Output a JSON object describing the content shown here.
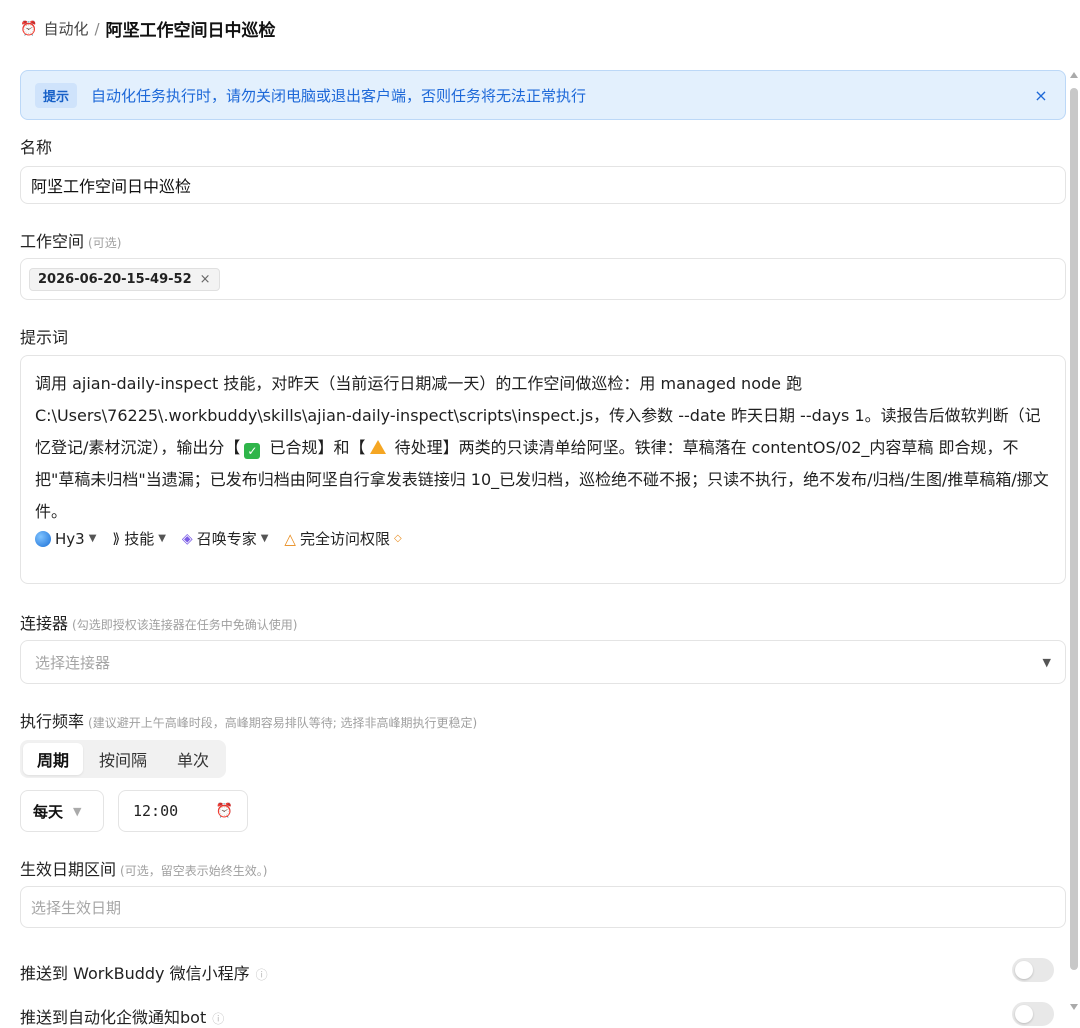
{
  "header": {
    "crumb": "自动化",
    "separator": "/",
    "title": "阿坚工作空间日中巡检"
  },
  "alert": {
    "tag": "提示",
    "message": "自动化任务执行时，请勿关闭电脑或退出客户端，否则任务将无法正常执行",
    "close": "×"
  },
  "name": {
    "label": "名称",
    "value": "阿坚工作空间日中巡检"
  },
  "workspace": {
    "label": "工作空间",
    "hint": "(可选)",
    "chip": "2026-06-20-15-49-52",
    "chip_remove": "×"
  },
  "prompt": {
    "label": "提示词",
    "part1": "调用 ajian-daily-inspect 技能，对昨天（当前运行日期减一天）的工作空间做巡检：用 managed node 跑 C:\\Users\\76225\\.workbuddy\\skills\\ajian-daily-inspect\\scripts\\inspect.js，传入参数 --date 昨天日期 --days 1。读报告后做软判断（记忆登记/素材沉淀），输出分【",
    "check_glyph": "✓",
    "part2": " 已合规】和【",
    "part3": " 待处理】两类的只读清单给阿坚。铁律：草稿落在 contentOS/02_内容草稿 即合规，不把\"草稿未归档\"当遗漏；已发布归档由阿坚自行拿发表链接归 10_已发归档，巡检绝不碰不报；只读不执行，绝不发布/归档/生图/推草稿箱/挪文件。",
    "toolbar": {
      "model": "Hy3",
      "skills": "技能",
      "expert": "召唤专家",
      "access": "完全访问权限"
    }
  },
  "connector": {
    "label": "连接器",
    "hint": "(勾选即授权该连接器在任务中免确认使用)",
    "placeholder": "选择连接器"
  },
  "frequency": {
    "label": "执行频率",
    "hint": "(建议避开上午高峰时段，高峰期容易排队等待; 选择非高峰期执行更稳定)",
    "tabs": [
      "周期",
      "按间隔",
      "单次"
    ],
    "period": "每天",
    "time": "12:00"
  },
  "date_range": {
    "label": "生效日期区间",
    "hint": "(可选，留空表示始终生效。)",
    "placeholder": "选择生效日期"
  },
  "push_wechat": {
    "label": "推送到 WorkBuddy 微信小程序"
  },
  "push_bot": {
    "label": "推送到自动化企微通知bot"
  },
  "colors": {
    "alert_bg": "#e3f0fd",
    "alert_text": "#1d68d8",
    "check_green": "#2fb54a",
    "warn_orange": "#e88a1a"
  },
  "icons": {
    "header": "alarm-clock-icon",
    "time": "alarm-clock-icon",
    "model": "hy-model-icon",
    "skills": "skill-icon",
    "expert": "graduation-cap-icon",
    "access": "warning-triangle-icon"
  }
}
